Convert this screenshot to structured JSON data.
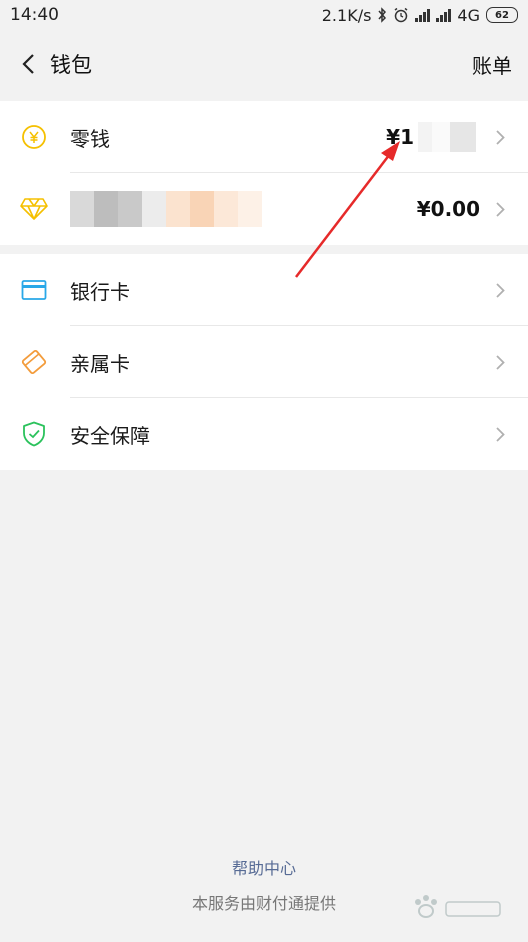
{
  "status": {
    "time": "14:40",
    "speed": "2.1K/s",
    "network": "4G",
    "battery": "62"
  },
  "header": {
    "title": "钱包",
    "right_label": "账单"
  },
  "balance_rows": [
    {
      "label": "零钱",
      "amount": "¥1",
      "icon": "yuan-coin-icon",
      "color": "#f5c000"
    },
    {
      "label": "",
      "amount": "¥0.00",
      "icon": "diamond-icon",
      "color": "#f5c000"
    }
  ],
  "menu_rows": [
    {
      "label": "银行卡",
      "icon": "bank-card-icon",
      "color": "#29a8e8"
    },
    {
      "label": "亲属卡",
      "icon": "family-card-icon",
      "color": "#f39c3c"
    },
    {
      "label": "安全保障",
      "icon": "shield-icon",
      "color": "#2bc25c"
    }
  ],
  "footer": {
    "help": "帮助中心",
    "service": "本服务由财付通提供"
  },
  "colors": {
    "background": "#f2f2f2",
    "link": "#576b95",
    "annotation_arrow": "#e62a2a"
  }
}
